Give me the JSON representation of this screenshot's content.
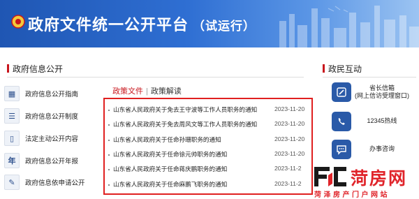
{
  "banner": {
    "title": "政府文件统一公开平台",
    "subtitle": "（试运行）",
    "icon": "emblem-icon"
  },
  "left": {
    "header": "政府信息公开",
    "items": [
      {
        "label": "政府信息公开指南",
        "icon": "guide-book-icon",
        "glyph": "▦"
      },
      {
        "label": "政府信息公开制度",
        "icon": "document-list-icon",
        "glyph": "☰"
      },
      {
        "label": "法定主动公开内容",
        "icon": "file-icon",
        "glyph": "▯"
      },
      {
        "label": "政府信息公开年报",
        "icon": "annual-report-icon",
        "glyph": "年"
      },
      {
        "label": "政府信息依申请公开",
        "icon": "application-icon",
        "glyph": "✎"
      }
    ]
  },
  "center": {
    "tabs": {
      "active": "政策文件",
      "separator": "|",
      "other": "政策解读"
    },
    "news": [
      {
        "title": "山东省人民政府关于免去王守波等工作人员职务的通知",
        "date": "2023-11-20"
      },
      {
        "title": "山东省人民政府关于免去周风文等工作人员职务的通知",
        "date": "2023-11-20"
      },
      {
        "title": "山东省人民政府关于任命孙珊职务的通知",
        "date": "2023-11-20"
      },
      {
        "title": "山东省人民政府关于任命徐元帅职务的通知",
        "date": "2023-11-20"
      },
      {
        "title": "山东省人民政府关于任命蒋庆鹏职务的通知",
        "date": "2023-11-2"
      },
      {
        "title": "山东省人民政府关于任命麻鹏飞职务的通知",
        "date": "2023-11-2"
      }
    ],
    "highlight_color": "#e02020"
  },
  "right": {
    "header": "政民互动",
    "items": [
      {
        "label_line1": "省长信箱",
        "label_line2": "(网上信访受理窗口)",
        "icon": "mailbox-icon"
      },
      {
        "label_line1": "12345热线",
        "label_line2": "",
        "icon": "phone-hotline-icon"
      },
      {
        "label_line1": "办事咨询",
        "label_line2": "",
        "icon": "consult-chat-icon"
      }
    ]
  },
  "watermark": {
    "brand": "菏房网",
    "tagline": "菏泽房产门户网站",
    "color": "#e0242a"
  },
  "colors": {
    "accent": "#c8161d",
    "banner_blue": "#2f6fd3",
    "icon_blue": "#2a5aa8"
  }
}
